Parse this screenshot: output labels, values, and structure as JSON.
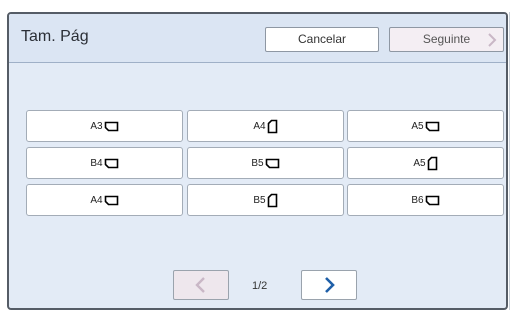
{
  "dialog": {
    "title": "Tam. Pág",
    "cancel_label": "Cancelar",
    "next_label": "Seguinte"
  },
  "sizes": [
    {
      "label": "A3",
      "orientation": "landscape"
    },
    {
      "label": "A4",
      "orientation": "portrait"
    },
    {
      "label": "A5",
      "orientation": "landscape"
    },
    {
      "label": "B4",
      "orientation": "landscape"
    },
    {
      "label": "B5",
      "orientation": "landscape"
    },
    {
      "label": "A5",
      "orientation": "portrait"
    },
    {
      "label": "A4",
      "orientation": "landscape"
    },
    {
      "label": "B5",
      "orientation": "portrait"
    },
    {
      "label": "B6",
      "orientation": "landscape"
    }
  ],
  "pager": {
    "page": "1/2"
  },
  "colors": {
    "accent": "#1f5fa8",
    "disabled": "#c9b7c6"
  }
}
